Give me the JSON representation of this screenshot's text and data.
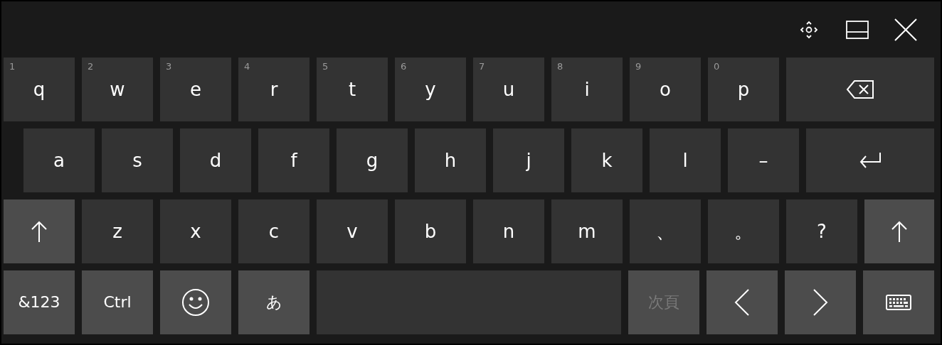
{
  "title_bar": {
    "buttons": [
      {
        "kind": "move"
      },
      {
        "kind": "dock"
      },
      {
        "kind": "close"
      }
    ]
  },
  "rows": [
    [
      {
        "kind": "char",
        "label": "q",
        "hint": "1",
        "function": false
      },
      {
        "kind": "char",
        "label": "w",
        "hint": "2",
        "function": false
      },
      {
        "kind": "char",
        "label": "e",
        "hint": "3",
        "function": false
      },
      {
        "kind": "char",
        "label": "r",
        "hint": "4",
        "function": false
      },
      {
        "kind": "char",
        "label": "t",
        "hint": "5",
        "function": false
      },
      {
        "kind": "char",
        "label": "y",
        "hint": "6",
        "function": false
      },
      {
        "kind": "char",
        "label": "u",
        "hint": "7",
        "function": false
      },
      {
        "kind": "char",
        "label": "i",
        "hint": "8",
        "function": false
      },
      {
        "kind": "char",
        "label": "o",
        "hint": "9",
        "function": false
      },
      {
        "kind": "char",
        "label": "p",
        "hint": "0",
        "function": false
      },
      {
        "kind": "backspace",
        "function": false
      }
    ],
    [
      {
        "kind": "char",
        "label": "a",
        "function": false
      },
      {
        "kind": "char",
        "label": "s",
        "function": false
      },
      {
        "kind": "char",
        "label": "d",
        "function": false
      },
      {
        "kind": "char",
        "label": "f",
        "function": false
      },
      {
        "kind": "char",
        "label": "g",
        "function": false
      },
      {
        "kind": "char",
        "label": "h",
        "function": false
      },
      {
        "kind": "char",
        "label": "j",
        "function": false
      },
      {
        "kind": "char",
        "label": "k",
        "function": false
      },
      {
        "kind": "char",
        "label": "l",
        "function": false
      },
      {
        "kind": "char",
        "label": "–",
        "function": false
      },
      {
        "kind": "enter",
        "function": false
      }
    ],
    [
      {
        "kind": "shift",
        "function": true
      },
      {
        "kind": "char",
        "label": "z",
        "function": false
      },
      {
        "kind": "char",
        "label": "x",
        "function": false
      },
      {
        "kind": "char",
        "label": "c",
        "function": false
      },
      {
        "kind": "char",
        "label": "v",
        "function": false
      },
      {
        "kind": "char",
        "label": "b",
        "function": false
      },
      {
        "kind": "char",
        "label": "n",
        "function": false
      },
      {
        "kind": "char",
        "label": "m",
        "function": false
      },
      {
        "kind": "char",
        "label": "、",
        "function": false
      },
      {
        "kind": "char",
        "label": "。",
        "function": false
      },
      {
        "kind": "char",
        "label": "?",
        "function": false
      },
      {
        "kind": "shift",
        "function": true
      }
    ],
    [
      {
        "kind": "char",
        "label": "&123",
        "function": true,
        "disabled": false
      },
      {
        "kind": "char",
        "label": "Ctrl",
        "function": true,
        "disabled": false
      },
      {
        "kind": "emoji",
        "function": true,
        "disabled": false
      },
      {
        "kind": "char",
        "label": "あ",
        "function": true,
        "disabled": false
      },
      {
        "kind": "space",
        "function": false
      },
      {
        "kind": "char",
        "label": "次頁",
        "function": true,
        "disabled": true
      },
      {
        "kind": "left",
        "function": true,
        "disabled": false
      },
      {
        "kind": "right",
        "function": true,
        "disabled": false
      },
      {
        "kind": "keyboard",
        "function": true,
        "disabled": false
      }
    ]
  ]
}
